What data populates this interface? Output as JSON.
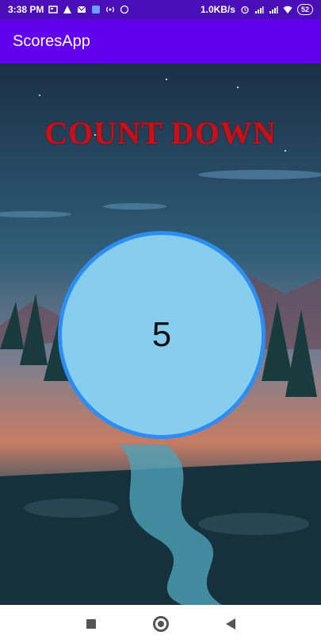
{
  "status_bar": {
    "time": "3:38 PM",
    "network_speed": "1.0KB/s",
    "battery": "52",
    "icons": [
      "notification-icon",
      "warning-icon",
      "gmail-icon",
      "vpn-icon",
      "hotspot-icon",
      "whatsapp-icon",
      "alarm-icon",
      "signal-icon",
      "signal-icon-2",
      "wifi-icon"
    ]
  },
  "app_bar": {
    "title": "ScoresApp"
  },
  "main": {
    "heading": "COUNT DOWN",
    "countdown_value": "5"
  },
  "colors": {
    "app_bar": "#6200ee",
    "status_bar": "#4a0fb8",
    "heading": "#c8101a",
    "circle_fill": "#87cdee",
    "circle_border": "#2d8df0"
  },
  "nav_bar": {
    "icons": [
      "recents-icon",
      "home-icon",
      "back-icon"
    ]
  }
}
